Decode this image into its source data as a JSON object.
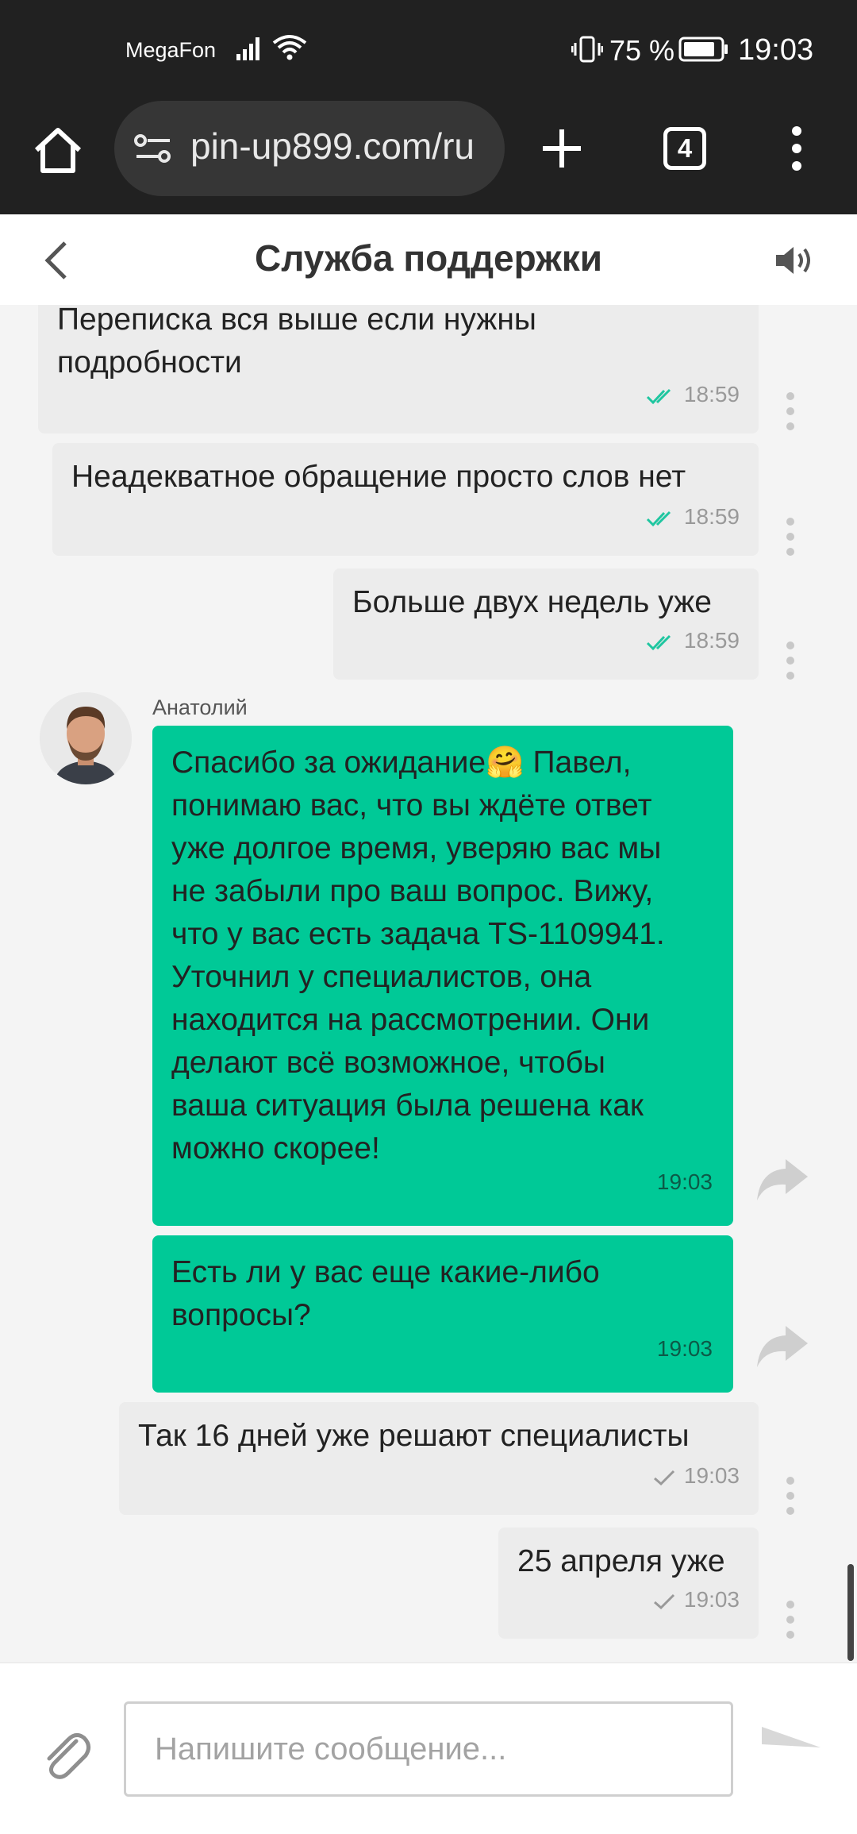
{
  "status_bar": {
    "carrier": "MegaFon",
    "battery_percent": "75 %",
    "time": "19:03"
  },
  "browser": {
    "url": "pin-up899.com/ru",
    "tab_count": "4"
  },
  "header": {
    "title": "Служба поддержки"
  },
  "messages": [
    {
      "text": "Переписка вся выше если нужны\nподробности",
      "time": "18:59",
      "sender": "user",
      "status": "read"
    },
    {
      "text": "Неадекватное обращение просто слов нет",
      "time": "18:59",
      "sender": "user",
      "status": "read"
    },
    {
      "text": "Больше двух недель уже",
      "time": "18:59",
      "sender": "user",
      "status": "read"
    },
    {
      "text": "Спасибо за ожидание🤗 Павел,\nпонимаю вас, что вы ждёте ответ\nуже долгое время, уверяю вас мы\nне забыли про ваш вопрос. Вижу,\nчто у вас есть задача TS-1109941.\nУточнил у специалистов, она\nнаходится на рассмотрении. Они\nделают всё возможное, чтобы\nваша ситуация была решена как\nможно скорее!",
      "time": "19:03",
      "sender": "agent"
    },
    {
      "text": "Есть ли у вас еще какие-либо\nвопросы?",
      "time": "19:03",
      "sender": "agent"
    },
    {
      "text": "Так 16 дней уже решают специалисты",
      "time": "19:03",
      "sender": "user",
      "status": "sent"
    },
    {
      "text": "25 апреля уже",
      "time": "19:03",
      "sender": "user",
      "status": "sent"
    }
  ],
  "agent": {
    "name": "Анатолий"
  },
  "composer": {
    "placeholder": "Напишите сообщение..."
  },
  "colors": {
    "agent_bubble": "#00c997",
    "read_check": "#1fc6a0",
    "user_bubble": "#ececec"
  }
}
